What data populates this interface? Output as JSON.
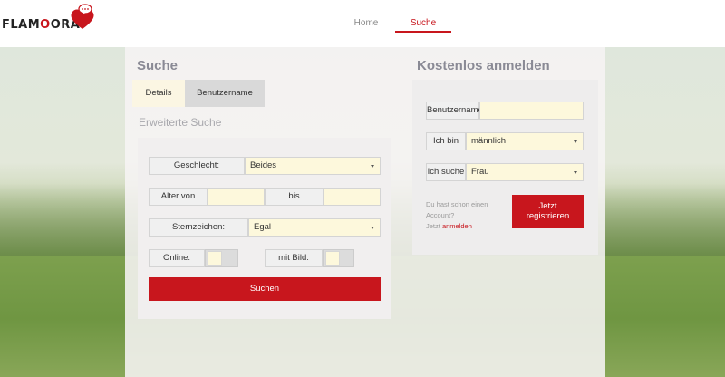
{
  "brand": {
    "name_prefix": "FLAM",
    "name_o1": "O",
    "name_o2": "O",
    "name_suffix": "RA",
    "accent": "#c8161d"
  },
  "nav": {
    "home": "Home",
    "suche": "Suche"
  },
  "search": {
    "title": "Suche",
    "tabs": {
      "details": "Details",
      "username": "Benutzername"
    },
    "subtitle": "Erweiterte Suche",
    "fields": {
      "gender_label": "Geschlecht:",
      "gender_value": "Beides",
      "age_from_label": "Alter von",
      "age_from_value": "",
      "age_to_label": "bis",
      "age_to_value": "",
      "zodiac_label": "Sternzeichen:",
      "zodiac_value": "Egal",
      "online_label": "Online:",
      "with_photo_label": "mit Bild:"
    },
    "submit": "Suchen"
  },
  "register": {
    "title": "Kostenlos anmelden",
    "username_label": "Benutzername",
    "username_value": "",
    "iam_label": "Ich bin",
    "iam_value": "männlich",
    "seek_label": "Ich suche",
    "seek_value": "Frau",
    "has_account_line1": "Du hast schon einen",
    "has_account_line2": "Account?",
    "login_prefix": "Jetzt ",
    "login_link": "anmelden",
    "register_button_line1": "Jetzt",
    "register_button_line2": "registrieren"
  }
}
